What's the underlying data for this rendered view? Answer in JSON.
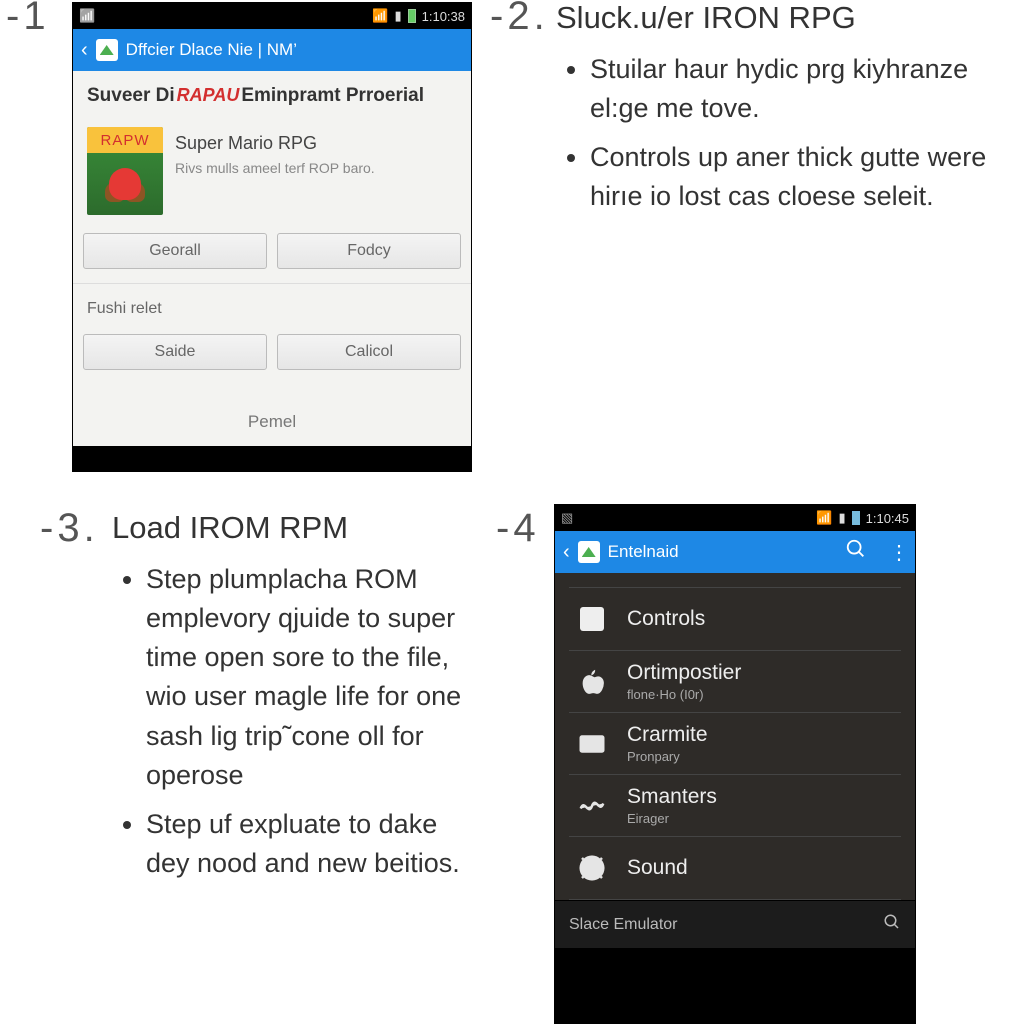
{
  "step1": {
    "num": "1",
    "statusbar_time": "1:10:38",
    "actionbar_title": "Dffcier Dlace Nie | NM’",
    "dialog_title_pre": "Suveer Di",
    "dialog_title_logo": "RAPAU",
    "dialog_title_post": "Eminpramt Prroerial",
    "game_title": "Super Mario RPG",
    "game_subtitle": "Rivs mulls ameel terf ROP baro.",
    "cover_word": "RAPW",
    "btn1": "Georall",
    "btn2": "Fodcy",
    "section_label": "Fushi relet",
    "btn3": "Saide",
    "btn4": "Calicol",
    "footer": "Pemel"
  },
  "step2": {
    "num": "2",
    "heading": "Sluck.u/er  IRON RPG",
    "bullets": [
      "Stuilar haur hydic prg kiyhranze el:ge me tove.",
      "Controls up aner thick gutte were hirıe io lost cas cloese seleit."
    ]
  },
  "step3": {
    "num": "3",
    "heading": "Load IROM RPM",
    "bullets": [
      "Step plumplacha ROM emplevory qjuide to super time open sore to the file, wio user magle life for one sash lig trip˜cone oll for operose",
      "Step uf expluate to dake dey nood and new beitios."
    ]
  },
  "step4": {
    "num": "4",
    "statusbar_time": "1:10:45",
    "actionbar_title": "Entelnaid",
    "items": [
      {
        "icon": "square",
        "label": "Controls",
        "sub": ""
      },
      {
        "icon": "apple",
        "label": "Ortimpostier",
        "sub": "flone·Ho (I0r)"
      },
      {
        "icon": "card",
        "label": "Crarmite",
        "sub": "Pronpary"
      },
      {
        "icon": "wave",
        "label": "Smanters",
        "sub": "Eirager"
      },
      {
        "icon": "gear",
        "label": "Sound",
        "sub": ""
      }
    ],
    "searchbar": "Slace Emulator"
  }
}
